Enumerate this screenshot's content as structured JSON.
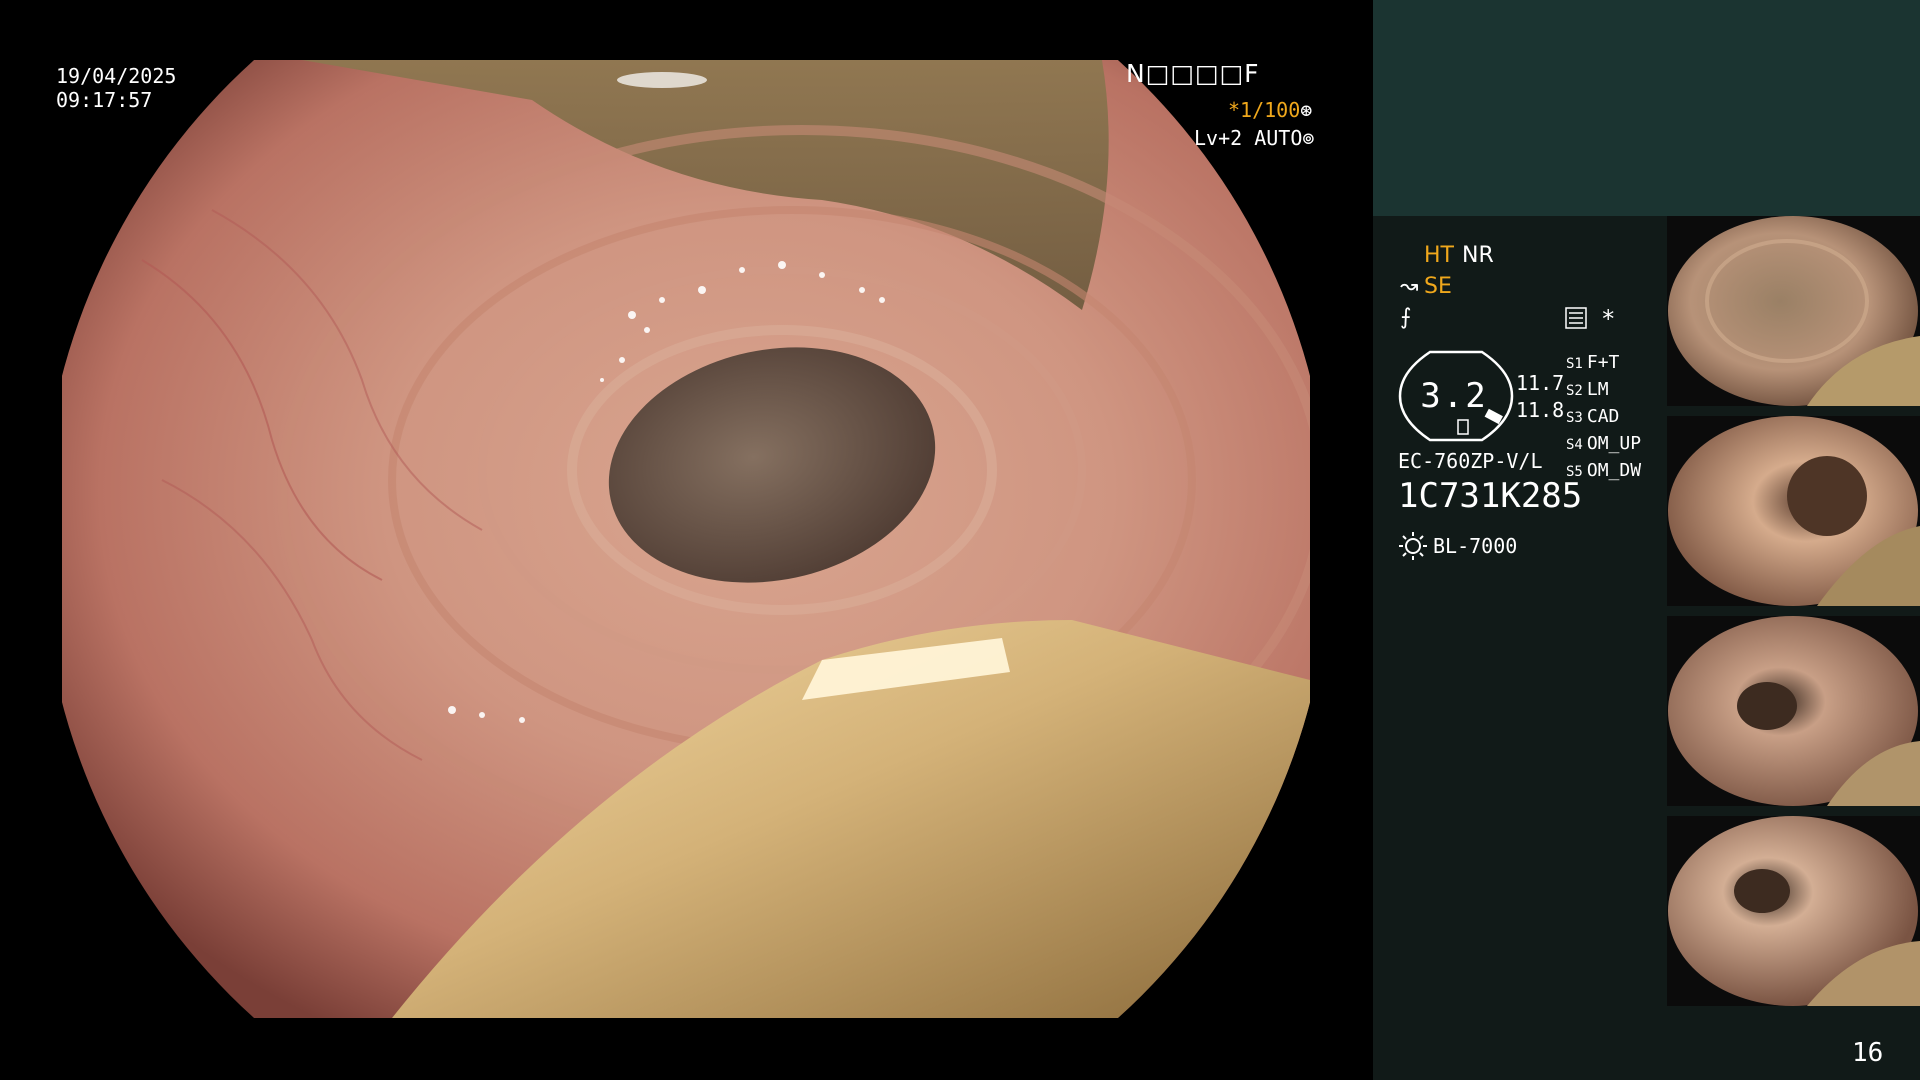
{
  "overlay": {
    "date": "19/04/2025",
    "time": "09:17:57",
    "code": "N□□□□F",
    "shutter": "*1/100",
    "shutter_symbol": "⊛",
    "level": "Lv+2 AUTO",
    "level_symbol": "⊚"
  },
  "panel": {
    "ht": "HT",
    "nr": "NR",
    "se_symbol": "↝",
    "se": "SE",
    "fn_symbol": "⨍",
    "asterisk": "*",
    "gauge_value": "3.2",
    "gauge_right_top": "11.7",
    "gauge_right_bottom": "11.8",
    "settings": [
      {
        "key": "S1",
        "value": "F+T"
      },
      {
        "key": "S2",
        "value": "LM"
      },
      {
        "key": "S3",
        "value": "CAD"
      },
      {
        "key": "S4",
        "value": "OM_UP"
      },
      {
        "key": "S5",
        "value": "OM_DW"
      }
    ],
    "scope_model": "EC-760ZP-V/L",
    "scope_serial": "1C731K285",
    "light_source": "BL-7000",
    "page_number": "16"
  },
  "colors": {
    "header": "#1b3431",
    "panel": "#111a18",
    "accent": "#f0a81c"
  }
}
